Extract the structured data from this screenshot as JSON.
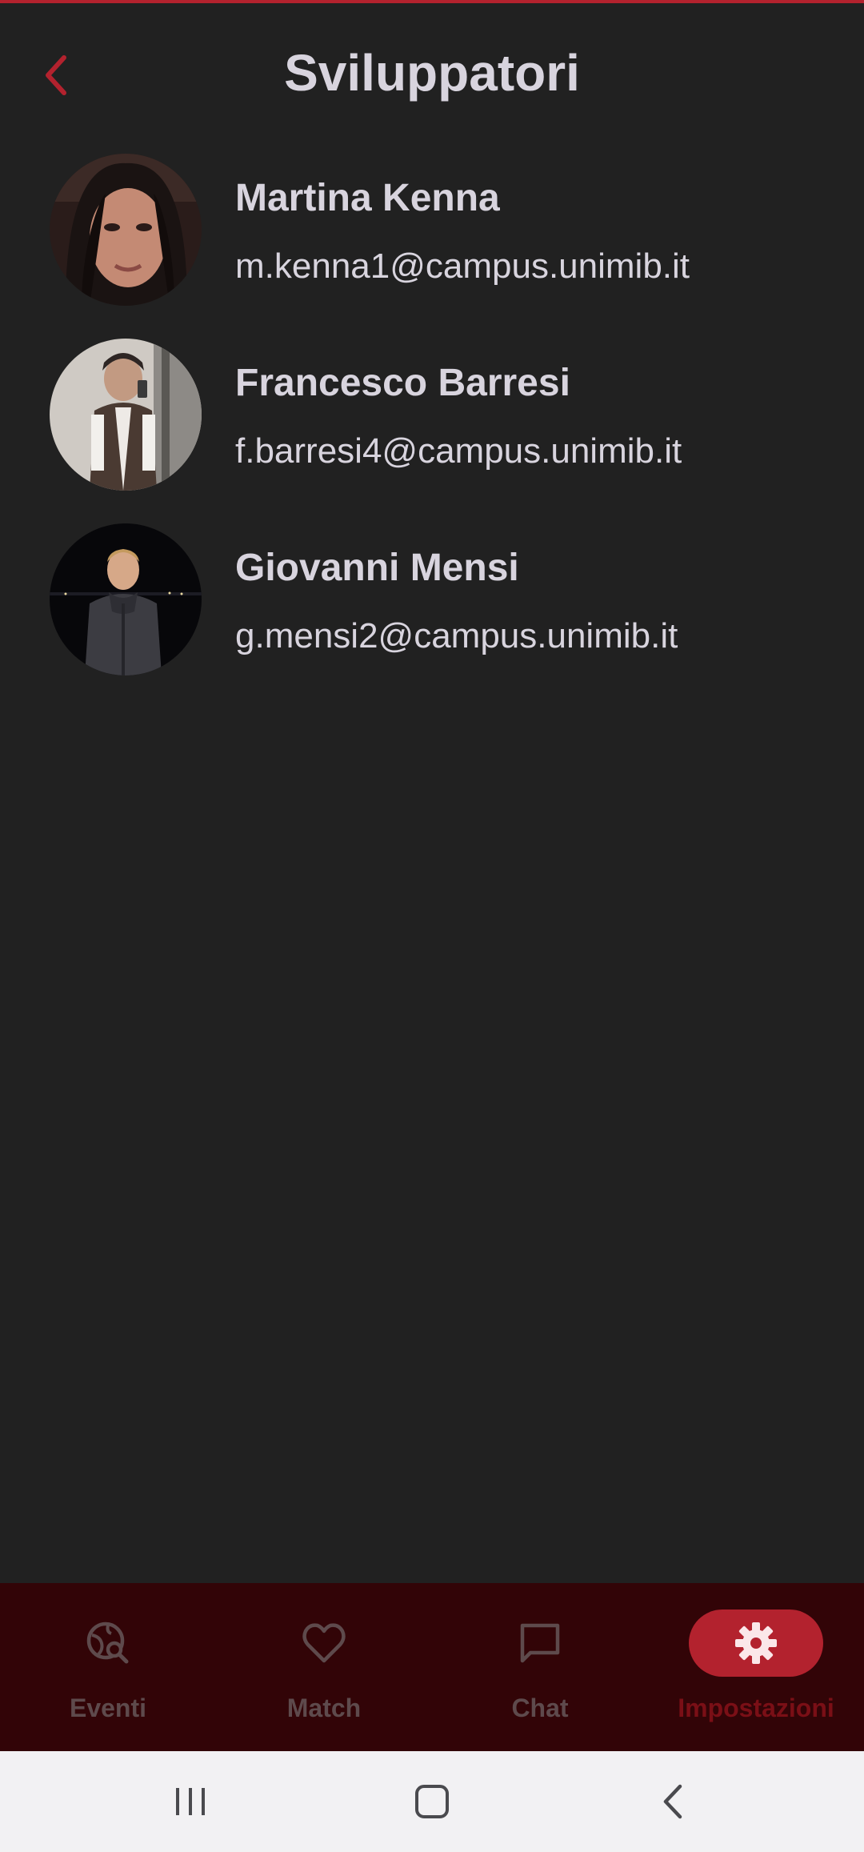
{
  "header": {
    "title": "Sviluppatori"
  },
  "developers": [
    {
      "name": "Martina Kenna",
      "email": "m.kenna1@campus.unimib.it"
    },
    {
      "name": "Francesco Barresi",
      "email": "f.barresi4@campus.unimib.it"
    },
    {
      "name": "Giovanni Mensi",
      "email": "g.mensi2@campus.unimib.it"
    }
  ],
  "bottom_nav": {
    "items": [
      {
        "label": "Eventi",
        "icon": "travel-explore-icon",
        "active": false
      },
      {
        "label": "Match",
        "icon": "heart-outline-icon",
        "active": false
      },
      {
        "label": "Chat",
        "icon": "chat-bubble-outline-icon",
        "active": false
      },
      {
        "label": "Impostazioni",
        "icon": "gear-icon",
        "active": true
      }
    ]
  },
  "colors": {
    "background": "#212121",
    "accent": "#b3222e",
    "nav_background": "#320407",
    "text": "#d8d4de",
    "nav_inactive": "#5e4a4c"
  }
}
